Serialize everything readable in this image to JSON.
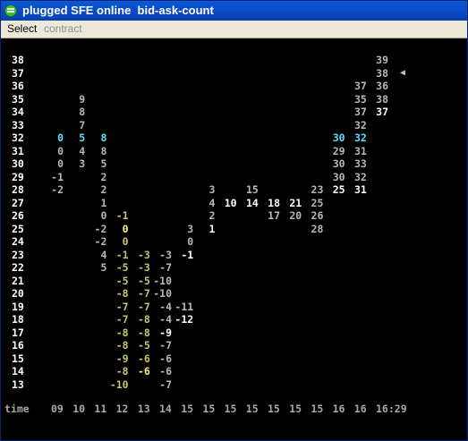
{
  "window": {
    "title": "plugged SFE online  bid-ask-count"
  },
  "menu": {
    "items": [
      {
        "label": "Select",
        "enabled": true
      },
      {
        "label": "contract",
        "enabled": false
      }
    ]
  },
  "chart_data": {
    "type": "table",
    "title": "bid-ask-count",
    "y_prices": [
      "38",
      "37",
      "36",
      "35",
      "34",
      "33",
      "32",
      "31",
      "30",
      "29",
      "28",
      "27",
      "26",
      "25",
      "24",
      "23",
      "22",
      "21",
      "20",
      "19",
      "18",
      "17",
      "16",
      "15",
      "14",
      "13"
    ],
    "time_label": "time",
    "times": [
      "09",
      "10",
      "11",
      "12",
      "13",
      "14",
      "15",
      "15",
      "15",
      "15",
      "15",
      "15",
      "15",
      "16",
      "16",
      "16:29"
    ],
    "current_price_marker": "◀",
    "colors": {
      "white": "#ffffff",
      "grey": "#b8b8b8",
      "cyan": "#58e0ff",
      "olive": "#c8c46a",
      "yellow": "#fff07a",
      "axis": "#a8a8a8"
    },
    "cells": [
      {
        "row": "38",
        "col": 15,
        "v": "39",
        "c": "grey"
      },
      {
        "row": "37",
        "col": 15,
        "v": "38",
        "c": "grey"
      },
      {
        "row": "36",
        "col": 14,
        "v": "37",
        "c": "grey"
      },
      {
        "row": "36",
        "col": 15,
        "v": "36",
        "c": "grey"
      },
      {
        "row": "35",
        "col": 1,
        "v": "9",
        "c": "grey"
      },
      {
        "row": "35",
        "col": 14,
        "v": "35",
        "c": "grey"
      },
      {
        "row": "35",
        "col": 15,
        "v": "38",
        "c": "grey"
      },
      {
        "row": "34",
        "col": 1,
        "v": "8",
        "c": "grey"
      },
      {
        "row": "34",
        "col": 14,
        "v": "37",
        "c": "grey"
      },
      {
        "row": "34",
        "col": 15,
        "v": "37",
        "c": "white"
      },
      {
        "row": "33",
        "col": 1,
        "v": "7",
        "c": "grey"
      },
      {
        "row": "33",
        "col": 14,
        "v": "32",
        "c": "grey"
      },
      {
        "row": "32",
        "col": 0,
        "v": "0",
        "c": "cyan"
      },
      {
        "row": "32",
        "col": 1,
        "v": "5",
        "c": "cyan"
      },
      {
        "row": "32",
        "col": 2,
        "v": "8",
        "c": "cyan"
      },
      {
        "row": "32",
        "col": 13,
        "v": "30",
        "c": "cyan"
      },
      {
        "row": "32",
        "col": 14,
        "v": "32",
        "c": "cyan"
      },
      {
        "row": "31",
        "col": 0,
        "v": "0",
        "c": "grey"
      },
      {
        "row": "31",
        "col": 1,
        "v": "4",
        "c": "grey"
      },
      {
        "row": "31",
        "col": 2,
        "v": "8",
        "c": "grey"
      },
      {
        "row": "31",
        "col": 13,
        "v": "29",
        "c": "grey"
      },
      {
        "row": "31",
        "col": 14,
        "v": "31",
        "c": "grey"
      },
      {
        "row": "30",
        "col": 0,
        "v": "0",
        "c": "grey"
      },
      {
        "row": "30",
        "col": 1,
        "v": "3",
        "c": "grey"
      },
      {
        "row": "30",
        "col": 2,
        "v": "5",
        "c": "grey"
      },
      {
        "row": "30",
        "col": 13,
        "v": "30",
        "c": "grey"
      },
      {
        "row": "30",
        "col": 14,
        "v": "33",
        "c": "grey"
      },
      {
        "row": "29",
        "col": 0,
        "v": "-1",
        "c": "grey"
      },
      {
        "row": "29",
        "col": 2,
        "v": "2",
        "c": "grey"
      },
      {
        "row": "29",
        "col": 13,
        "v": "30",
        "c": "grey"
      },
      {
        "row": "29",
        "col": 14,
        "v": "32",
        "c": "grey"
      },
      {
        "row": "28",
        "col": 0,
        "v": "-2",
        "c": "grey"
      },
      {
        "row": "28",
        "col": 2,
        "v": "2",
        "c": "grey"
      },
      {
        "row": "28",
        "col": 7,
        "v": "3",
        "c": "grey"
      },
      {
        "row": "28",
        "col": 9,
        "v": "15",
        "c": "grey"
      },
      {
        "row": "28",
        "col": 12,
        "v": "23",
        "c": "grey"
      },
      {
        "row": "28",
        "col": 13,
        "v": "25",
        "c": "white"
      },
      {
        "row": "28",
        "col": 14,
        "v": "31",
        "c": "white"
      },
      {
        "row": "27",
        "col": 2,
        "v": "1",
        "c": "grey"
      },
      {
        "row": "27",
        "col": 7,
        "v": "4",
        "c": "grey"
      },
      {
        "row": "27",
        "col": 8,
        "v": "10",
        "c": "white"
      },
      {
        "row": "27",
        "col": 9,
        "v": "14",
        "c": "white"
      },
      {
        "row": "27",
        "col": 10,
        "v": "18",
        "c": "white"
      },
      {
        "row": "27",
        "col": 11,
        "v": "21",
        "c": "white"
      },
      {
        "row": "27",
        "col": 12,
        "v": "25",
        "c": "grey"
      },
      {
        "row": "26",
        "col": 2,
        "v": "0",
        "c": "grey"
      },
      {
        "row": "26",
        "col": 3,
        "v": "-1",
        "c": "olive"
      },
      {
        "row": "26",
        "col": 7,
        "v": "2",
        "c": "grey"
      },
      {
        "row": "26",
        "col": 10,
        "v": "17",
        "c": "grey"
      },
      {
        "row": "26",
        "col": 11,
        "v": "20",
        "c": "grey"
      },
      {
        "row": "26",
        "col": 12,
        "v": "26",
        "c": "grey"
      },
      {
        "row": "25",
        "col": 2,
        "v": "-2",
        "c": "grey"
      },
      {
        "row": "25",
        "col": 3,
        "v": "0",
        "c": "yellow"
      },
      {
        "row": "25",
        "col": 6,
        "v": "3",
        "c": "grey"
      },
      {
        "row": "25",
        "col": 7,
        "v": "1",
        "c": "white"
      },
      {
        "row": "25",
        "col": 12,
        "v": "28",
        "c": "grey"
      },
      {
        "row": "24",
        "col": 2,
        "v": "-2",
        "c": "grey"
      },
      {
        "row": "24",
        "col": 3,
        "v": "0",
        "c": "olive"
      },
      {
        "row": "24",
        "col": 6,
        "v": "0",
        "c": "grey"
      },
      {
        "row": "23",
        "col": 2,
        "v": "4",
        "c": "grey"
      },
      {
        "row": "23",
        "col": 3,
        "v": "-1",
        "c": "olive"
      },
      {
        "row": "23",
        "col": 4,
        "v": "-3",
        "c": "olive"
      },
      {
        "row": "23",
        "col": 5,
        "v": "-3",
        "c": "grey"
      },
      {
        "row": "23",
        "col": 6,
        "v": "-1",
        "c": "white"
      },
      {
        "row": "22",
        "col": 2,
        "v": "5",
        "c": "grey"
      },
      {
        "row": "22",
        "col": 3,
        "v": "-5",
        "c": "olive"
      },
      {
        "row": "22",
        "col": 4,
        "v": "-3",
        "c": "olive"
      },
      {
        "row": "22",
        "col": 5,
        "v": "-7",
        "c": "grey"
      },
      {
        "row": "21",
        "col": 3,
        "v": "-5",
        "c": "olive"
      },
      {
        "row": "21",
        "col": 4,
        "v": "-5",
        "c": "olive"
      },
      {
        "row": "21",
        "col": 5,
        "v": "-10",
        "c": "grey"
      },
      {
        "row": "20",
        "col": 3,
        "v": "-8",
        "c": "olive"
      },
      {
        "row": "20",
        "col": 4,
        "v": "-7",
        "c": "olive"
      },
      {
        "row": "20",
        "col": 5,
        "v": "-10",
        "c": "grey"
      },
      {
        "row": "19",
        "col": 3,
        "v": "-7",
        "c": "olive"
      },
      {
        "row": "19",
        "col": 4,
        "v": "-7",
        "c": "olive"
      },
      {
        "row": "19",
        "col": 5,
        "v": "-4",
        "c": "grey"
      },
      {
        "row": "19",
        "col": 6,
        "v": "-11",
        "c": "grey"
      },
      {
        "row": "18",
        "col": 3,
        "v": "-7",
        "c": "olive"
      },
      {
        "row": "18",
        "col": 4,
        "v": "-8",
        "c": "olive"
      },
      {
        "row": "18",
        "col": 5,
        "v": "-4",
        "c": "grey"
      },
      {
        "row": "18",
        "col": 6,
        "v": "-12",
        "c": "white"
      },
      {
        "row": "17",
        "col": 3,
        "v": "-8",
        "c": "olive"
      },
      {
        "row": "17",
        "col": 4,
        "v": "-8",
        "c": "olive"
      },
      {
        "row": "17",
        "col": 5,
        "v": "-9",
        "c": "white"
      },
      {
        "row": "16",
        "col": 3,
        "v": "-8",
        "c": "olive"
      },
      {
        "row": "16",
        "col": 4,
        "v": "-5",
        "c": "olive"
      },
      {
        "row": "16",
        "col": 5,
        "v": "-7",
        "c": "grey"
      },
      {
        "row": "15",
        "col": 3,
        "v": "-9",
        "c": "olive"
      },
      {
        "row": "15",
        "col": 4,
        "v": "-6",
        "c": "olive"
      },
      {
        "row": "15",
        "col": 5,
        "v": "-6",
        "c": "grey"
      },
      {
        "row": "14",
        "col": 3,
        "v": "-8",
        "c": "olive"
      },
      {
        "row": "14",
        "col": 4,
        "v": "-6",
        "c": "yellow"
      },
      {
        "row": "14",
        "col": 5,
        "v": "-6",
        "c": "grey"
      },
      {
        "row": "13",
        "col": 3,
        "v": "-10",
        "c": "olive"
      },
      {
        "row": "13",
        "col": 5,
        "v": "-7",
        "c": "grey"
      }
    ]
  }
}
